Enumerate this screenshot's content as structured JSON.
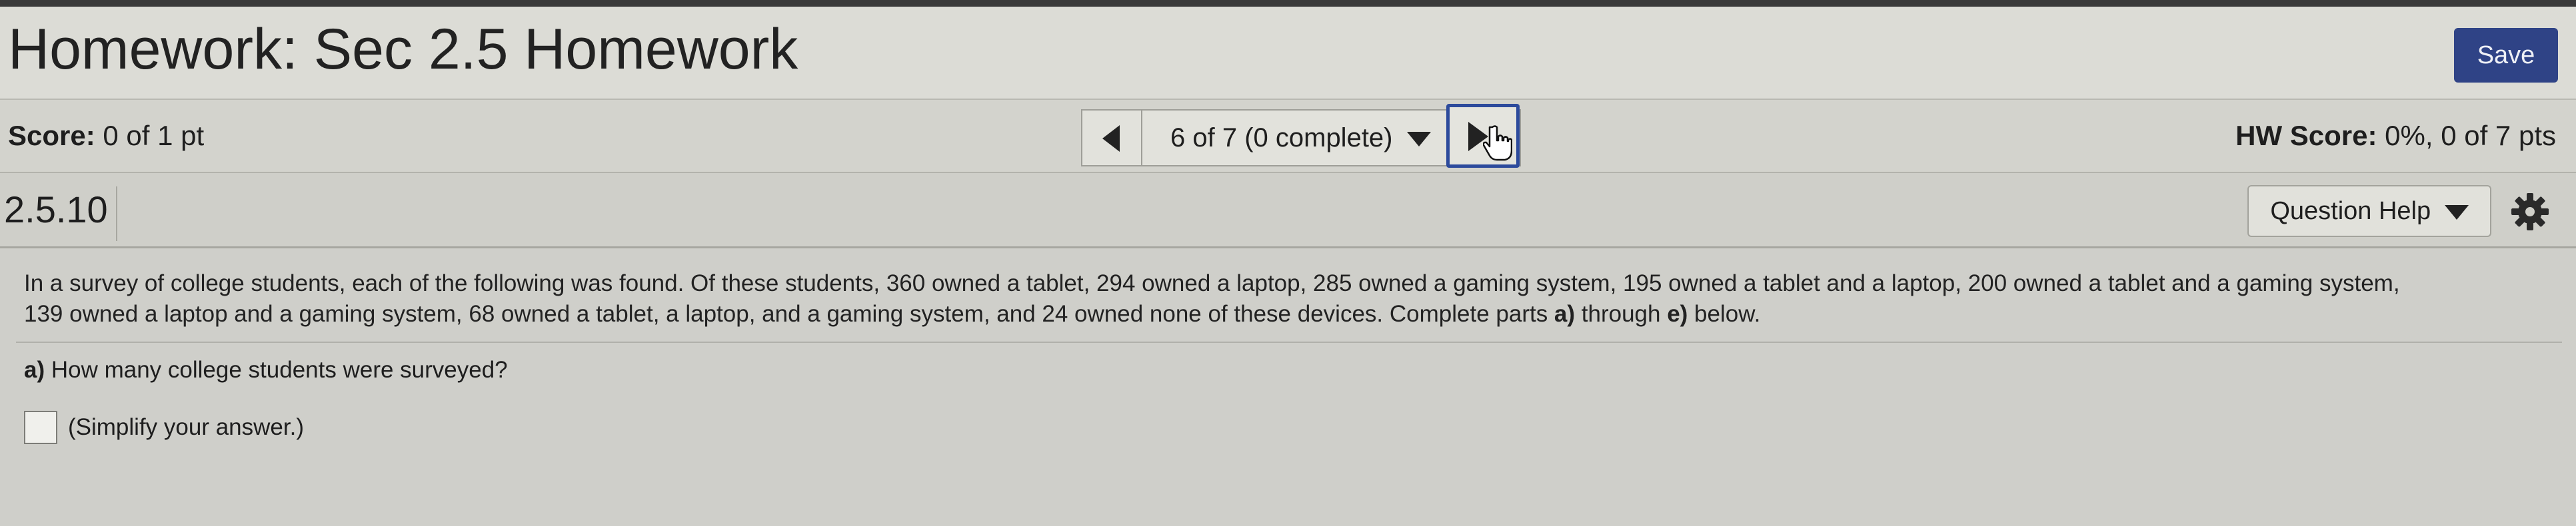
{
  "header": {
    "title": "Homework: Sec 2.5 Homework",
    "save_label": "Save"
  },
  "score_bar": {
    "score_label": "Score:",
    "score_value": "0 of 1 pt",
    "question_selector": "6 of 7 (0 complete)",
    "hw_score_label": "HW Score:",
    "hw_score_value": "0%, 0 of 7 pts"
  },
  "question_bar": {
    "number": "2.5.10",
    "help_label": "Question Help"
  },
  "problem": {
    "line1": "In a survey of college students, each of the following was found. Of these students, 360 owned a tablet, 294 owned a laptop, 285 owned a gaming system, 195 owned a tablet and a laptop, 200 owned a tablet and a gaming system,",
    "line2_prefix": "139 owned a laptop and a gaming system, 68 owned a tablet, a laptop, and a gaming system, and 24 owned none of these devices. Complete parts ",
    "part_a_ref": "a)",
    "through": " through ",
    "part_e_ref": "e)",
    "line2_suffix": " below."
  },
  "part_a": {
    "label": "a)",
    "question": " How many college students were surveyed?",
    "answer_value": "",
    "hint": "(Simplify your answer.)"
  },
  "icons": {
    "prev": "triangle-left-icon",
    "next": "triangle-right-icon",
    "cursor": "hand-pointer-icon",
    "dropdown": "caret-down-icon",
    "settings": "gear-icon"
  },
  "colors": {
    "save_button": "#2f4386",
    "next_focus_border": "#2c4a9c"
  }
}
